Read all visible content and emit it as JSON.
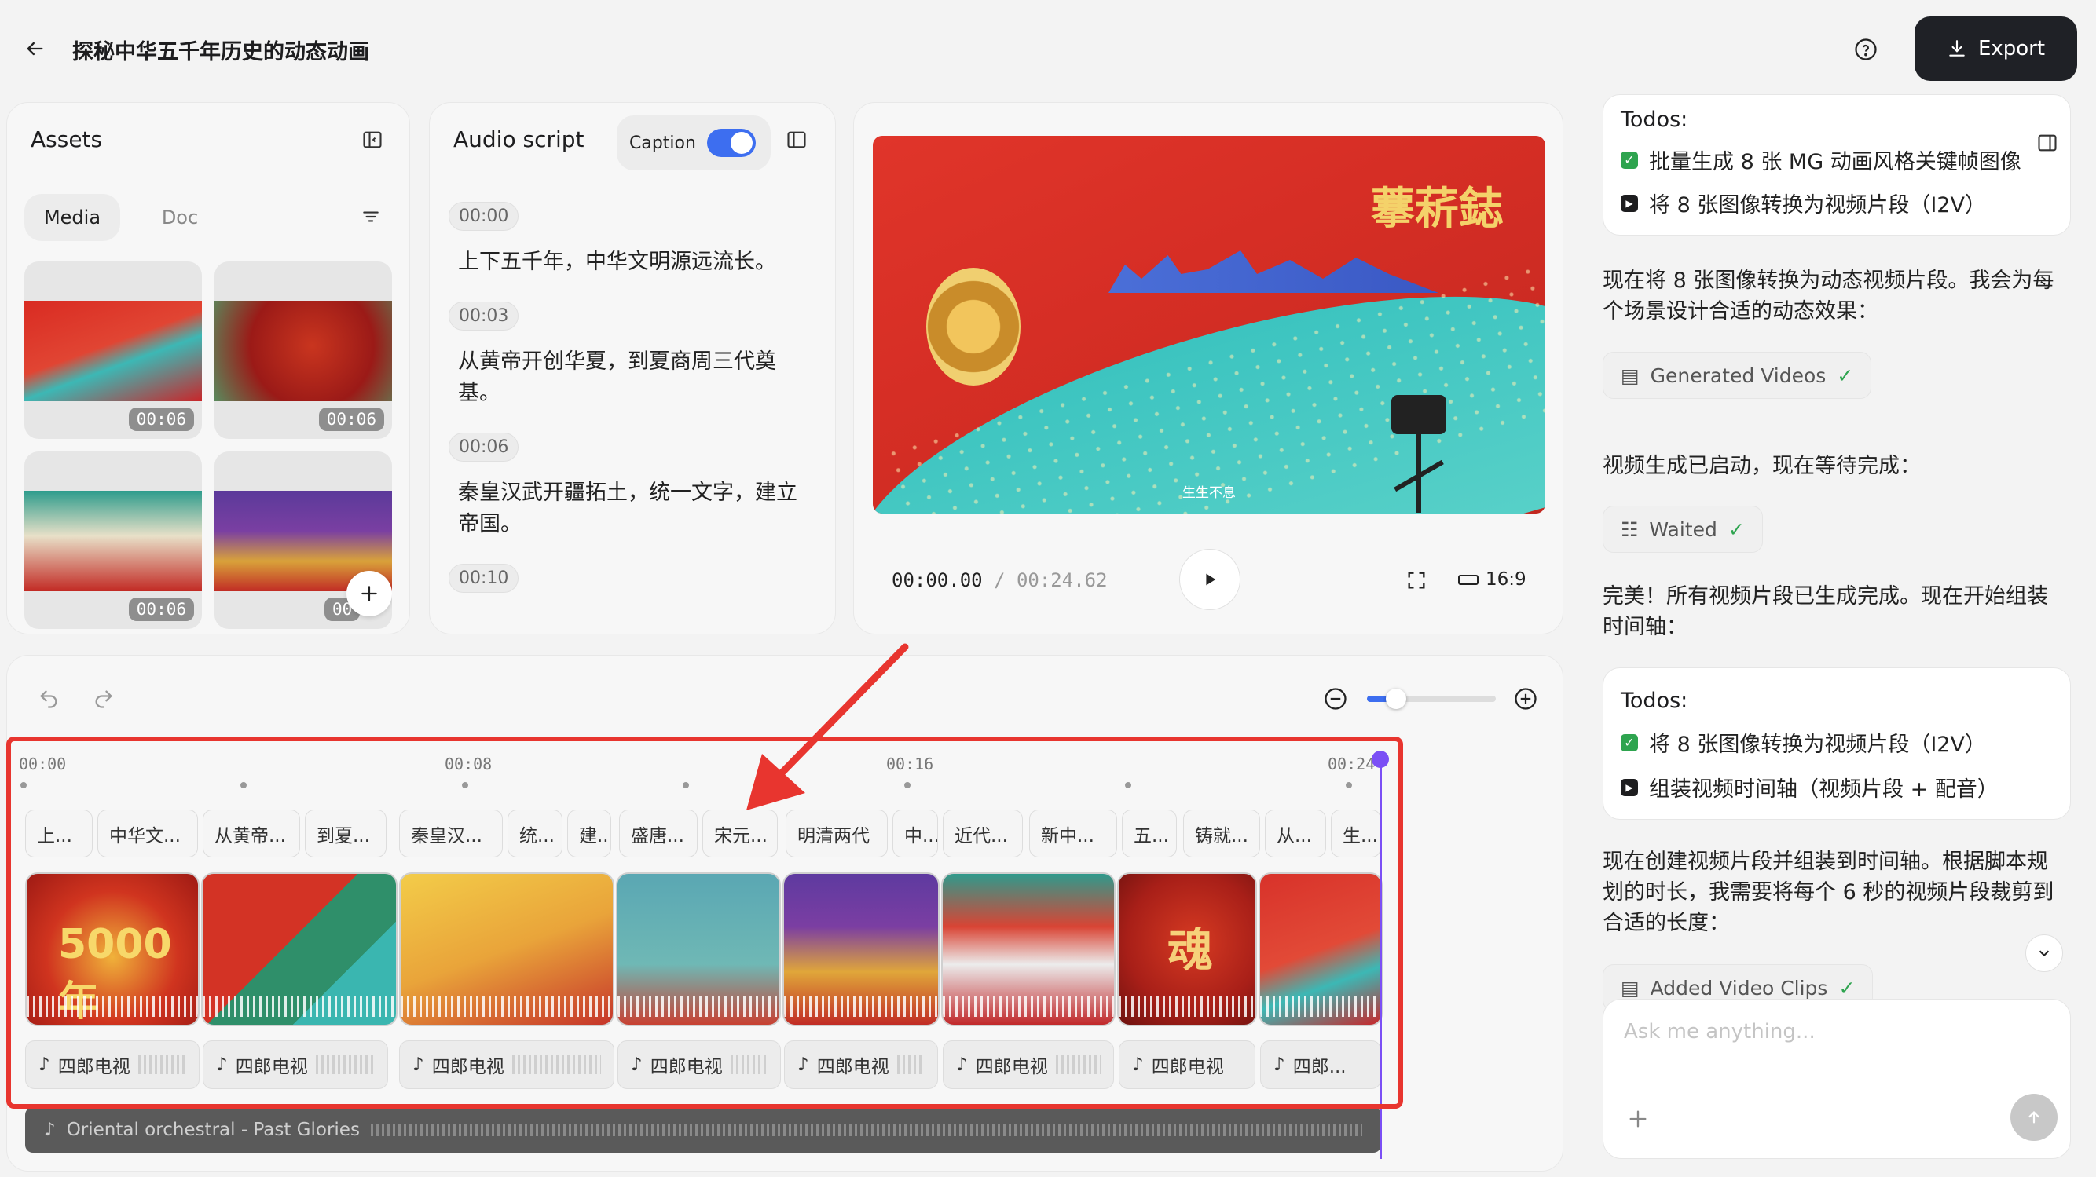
{
  "header": {
    "back_icon": "arrow-left-icon",
    "title": "探秘中华五千年历史的动态动画",
    "help_icon": "question-circle-icon",
    "export_label": "Export"
  },
  "assets": {
    "title": "Assets",
    "tabs": [
      {
        "label": "Media",
        "active": true
      },
      {
        "label": "Doc",
        "active": false
      }
    ],
    "thumbs": [
      {
        "duration": "00:06"
      },
      {
        "duration": "00:06"
      },
      {
        "duration": "00:06"
      },
      {
        "duration": "00"
      }
    ]
  },
  "audio_script": {
    "title": "Audio script",
    "caption_label": "Caption",
    "caption_on": true,
    "entries": [
      {
        "time": "00:00",
        "text": "上下五千年，中华文明源远流长。"
      },
      {
        "time": "00:03",
        "text": "从黄帝开创华夏，到夏商周三代奠基。"
      },
      {
        "time": "00:06",
        "text": "秦皇汉武开疆拓土，统一文字，建立帝国。"
      },
      {
        "time": "00:10",
        "text": ""
      }
    ]
  },
  "preview": {
    "overlay_title": "藆菥鋕",
    "overlay_caption": "生生不息",
    "current_time": "00:00.00",
    "separator": "/",
    "total_time": "00:24.62",
    "aspect": "16:9"
  },
  "timeline": {
    "ticks": [
      "00:00",
      "00:08",
      "00:16",
      "00:24"
    ],
    "text_clips": [
      "上...",
      "中华文...",
      "从黄帝...",
      "到夏...",
      "秦皇汉...",
      "统...",
      "建...",
      "盛唐...",
      "宋元...",
      "明清两代",
      "中...",
      "近代...",
      "新中...",
      "五...",
      "铸就...",
      "从...",
      "生..."
    ],
    "video_clips": [
      {
        "label": "5000年"
      },
      {
        "label": ""
      },
      {
        "label": ""
      },
      {
        "label": ""
      },
      {
        "label": ""
      },
      {
        "label": ""
      },
      {
        "label": "魂"
      },
      {
        "label": ""
      }
    ],
    "audio_clips": [
      "四郎电视",
      "四郎电视",
      "四郎电视",
      "四郎电视",
      "四郎电视",
      "四郎电视",
      "四郎电视",
      "四郎..."
    ],
    "music_track": "Oriental orchestral - Past Glories"
  },
  "chat": {
    "todos_1": {
      "title": "Todos:",
      "items": [
        {
          "text": "批量生成 8 张 MG 动画风格关键帧图像",
          "status": "done"
        },
        {
          "text": "将 8 张图像转换为视频片段（I2V）",
          "status": "in-progress"
        }
      ]
    },
    "msg_1": "现在将 8 张图像转换为动态视频片段。我会为每个场景设计合适的动态效果：",
    "pill_1": "Generated Videos",
    "msg_2": "视频生成已启动，现在等待完成：",
    "pill_2": "Waited",
    "msg_3": "完美！所有视频片段已生成完成。现在开始组装时间轴：",
    "todos_2": {
      "title": "Todos:",
      "items": [
        {
          "text": "将 8 张图像转换为视频片段（I2V）",
          "status": "done"
        },
        {
          "text": "组装视频时间轴（视频片段 + 配音）",
          "status": "in-progress"
        }
      ]
    },
    "msg_4": "现在创建视频片段并组装到时间轴。根据脚本规划的时长，我需要将每个 6 秒的视频片段裁剪到合适的长度：",
    "pill_3": "Added Video Clips",
    "input_placeholder": "Ask me anything..."
  },
  "colors": {
    "accent": "#3d6ef0",
    "highlight_red": "#e8352f",
    "export_bg": "#1f2126",
    "playhead": "#7b4ff5"
  }
}
